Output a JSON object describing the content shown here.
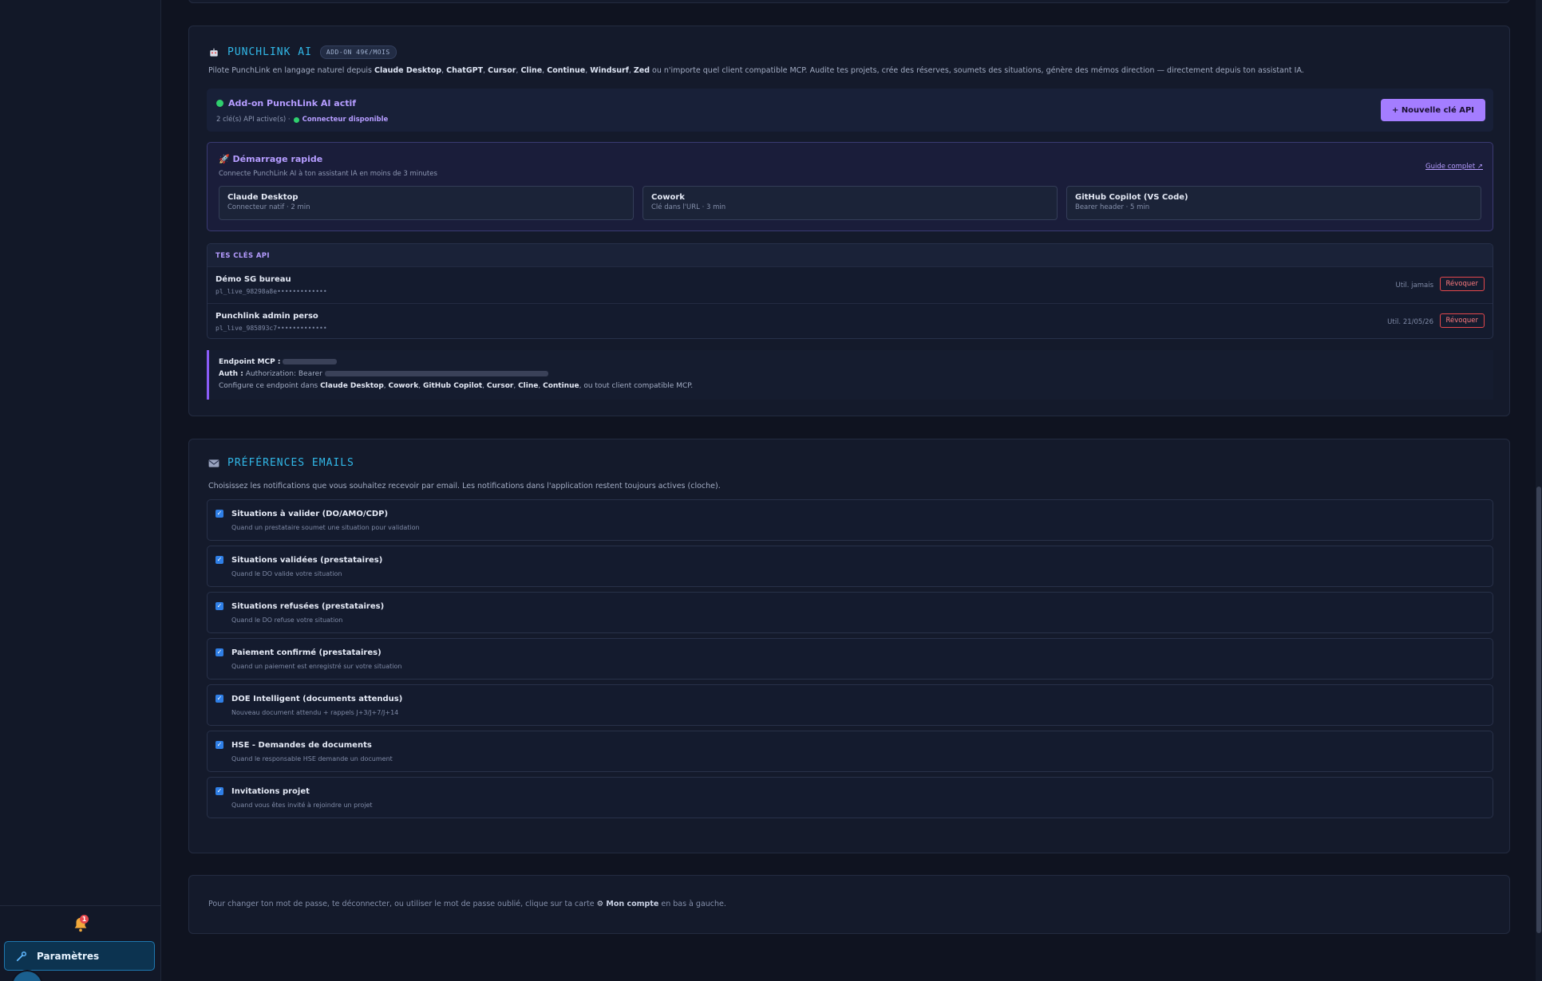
{
  "sidebar": {
    "notification_count": "1",
    "settings_label": "Paramètres"
  },
  "ai": {
    "icon": "robot-icon",
    "title": "PUNCHLINK AI",
    "tag": "ADD-ON 49€/MOIS",
    "description_prefix": "Pilote PunchLink en langage naturel depuis ",
    "clients": [
      "Claude Desktop",
      "ChatGPT",
      "Cursor",
      "Cline",
      "Continue",
      "Windsurf",
      "Zed"
    ],
    "description_suffix": " ou n'importe quel client compatible MCP. Audite tes projets, crée des réserves, soumets des situations, génère des mémos direction — directement depuis ton assistant IA.",
    "addon_title": "Add-on PunchLink AI actif",
    "addon_keys": "2 clé(s) API active(s) ·",
    "addon_connector": "Connecteur disponible",
    "new_key_label": "+ Nouvelle clé API",
    "quick": {
      "title": "Démarrage rapide",
      "subtitle": "Connecte PunchLink AI à ton assistant IA en moins de 3 minutes",
      "guide_link": "Guide complet ↗",
      "cards": [
        {
          "name": "Claude Desktop",
          "sub": "Connecteur natif · 2 min"
        },
        {
          "name": "Cowork",
          "sub": "Clé dans l'URL · 3 min"
        },
        {
          "name": "GitHub Copilot (VS Code)",
          "sub": "Bearer header · 5 min"
        }
      ]
    },
    "keys": {
      "header": "TES CLÉS API",
      "rows": [
        {
          "name": "Démo SG bureau",
          "value": "pl_live_98298a8e•••••••••••••",
          "used": "Util. jamais",
          "revoke": "Révoquer"
        },
        {
          "name": "Punchlink admin perso",
          "value": "pl_live_985893c7•••••••••••••",
          "used": "Util. 21/05/26",
          "revoke": "Révoquer"
        }
      ]
    },
    "endpoint": {
      "label": "Endpoint MCP :",
      "auth_label": "Auth :",
      "auth_text": "Authorization: Bearer",
      "config_prefix": "Configure ce endpoint dans ",
      "config_clients": [
        "Claude Desktop",
        "Cowork",
        "GitHub Copilot",
        "Cursor",
        "Cline",
        "Continue"
      ],
      "config_suffix": ", ou tout client compatible MCP."
    }
  },
  "email": {
    "icon": "envelope-icon",
    "title": "PRÉFÉRENCES EMAILS",
    "description": "Choisissez les notifications que vous souhaitez recevoir par email. Les notifications dans l'application restent toujours actives (cloche).",
    "items": [
      {
        "label": "Situations à valider (DO/AMO/CDP)",
        "sub": "Quand un prestataire soumet une situation pour validation",
        "checked": true
      },
      {
        "label": "Situations validées (prestataires)",
        "sub": "Quand le DO valide votre situation",
        "checked": true
      },
      {
        "label": "Situations refusées (prestataires)",
        "sub": "Quand le DO refuse votre situation",
        "checked": true
      },
      {
        "label": "Paiement confirmé (prestataires)",
        "sub": "Quand un paiement est enregistré sur votre situation",
        "checked": true
      },
      {
        "label": "DOE Intelligent (documents attendus)",
        "sub": "Nouveau document attendu + rappels J+3/J+7/J+14",
        "checked": true
      },
      {
        "label": "HSE - Demandes de documents",
        "sub": "Quand le responsable HSE demande un document",
        "checked": true
      },
      {
        "label": "Invitations projet",
        "sub": "Quand vous êtes invité à rejoindre un projet",
        "checked": true
      }
    ]
  },
  "footer": {
    "text_prefix": "Pour changer ton mot de passe, te déconnecter, ou utiliser le mot de passe oublié, clique sur ta carte ",
    "account_label": "Mon compte",
    "text_suffix": " en bas à gauche."
  },
  "colors": {
    "accent_cyan": "#31b8e8",
    "accent_purple": "#a47dff",
    "danger": "#e5484d",
    "success": "#2fcf6e"
  }
}
